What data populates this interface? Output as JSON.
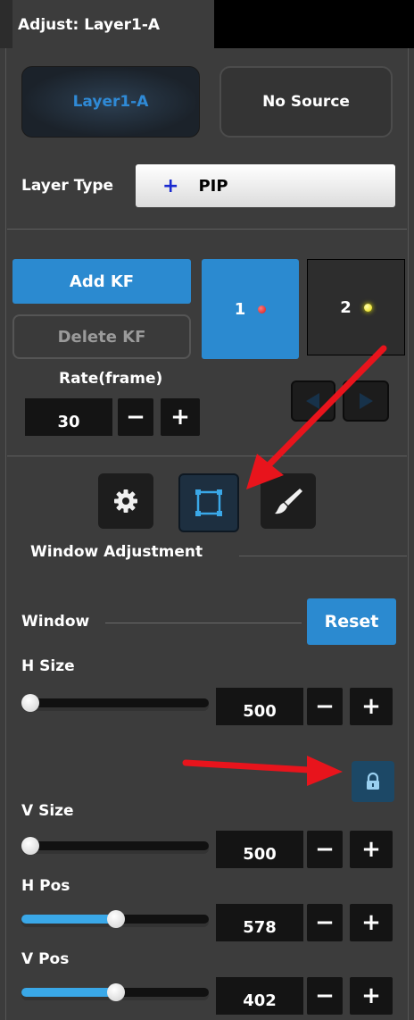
{
  "panel": {
    "title": "Adjust: Layer1-A"
  },
  "source": {
    "layer_label": "Layer1-A",
    "no_source_label": "No Source"
  },
  "layer_type": {
    "label": "Layer Type",
    "plus": "+",
    "value": "PIP"
  },
  "keyframes": {
    "add_label": "Add KF",
    "delete_label": "Delete KF",
    "kf1_label": "1",
    "kf2_label": "2",
    "rate_label": "Rate(frame)",
    "rate_value": "30"
  },
  "tools": {
    "active": "window-adjustment"
  },
  "window_adjustment": {
    "section_title": "Window Adjustment",
    "window_label": "Window",
    "reset_label": "Reset",
    "h_size": {
      "label": "H Size",
      "value": "500",
      "slider_fraction": 0.0
    },
    "v_size": {
      "label": "V Size",
      "value": "500",
      "slider_fraction": 0.0
    },
    "h_pos": {
      "label": "H Pos",
      "value": "578",
      "slider_fraction": 0.5
    },
    "v_pos": {
      "label": "V Pos",
      "value": "402",
      "slider_fraction": 0.5
    }
  },
  "steppers": {
    "minus": "−",
    "plus": "+"
  },
  "colors": {
    "accent": "#2b8ad0",
    "background": "#3c3c3c",
    "annotation_arrow": "#e8141c",
    "slider_fill": "#3aa8e8"
  }
}
